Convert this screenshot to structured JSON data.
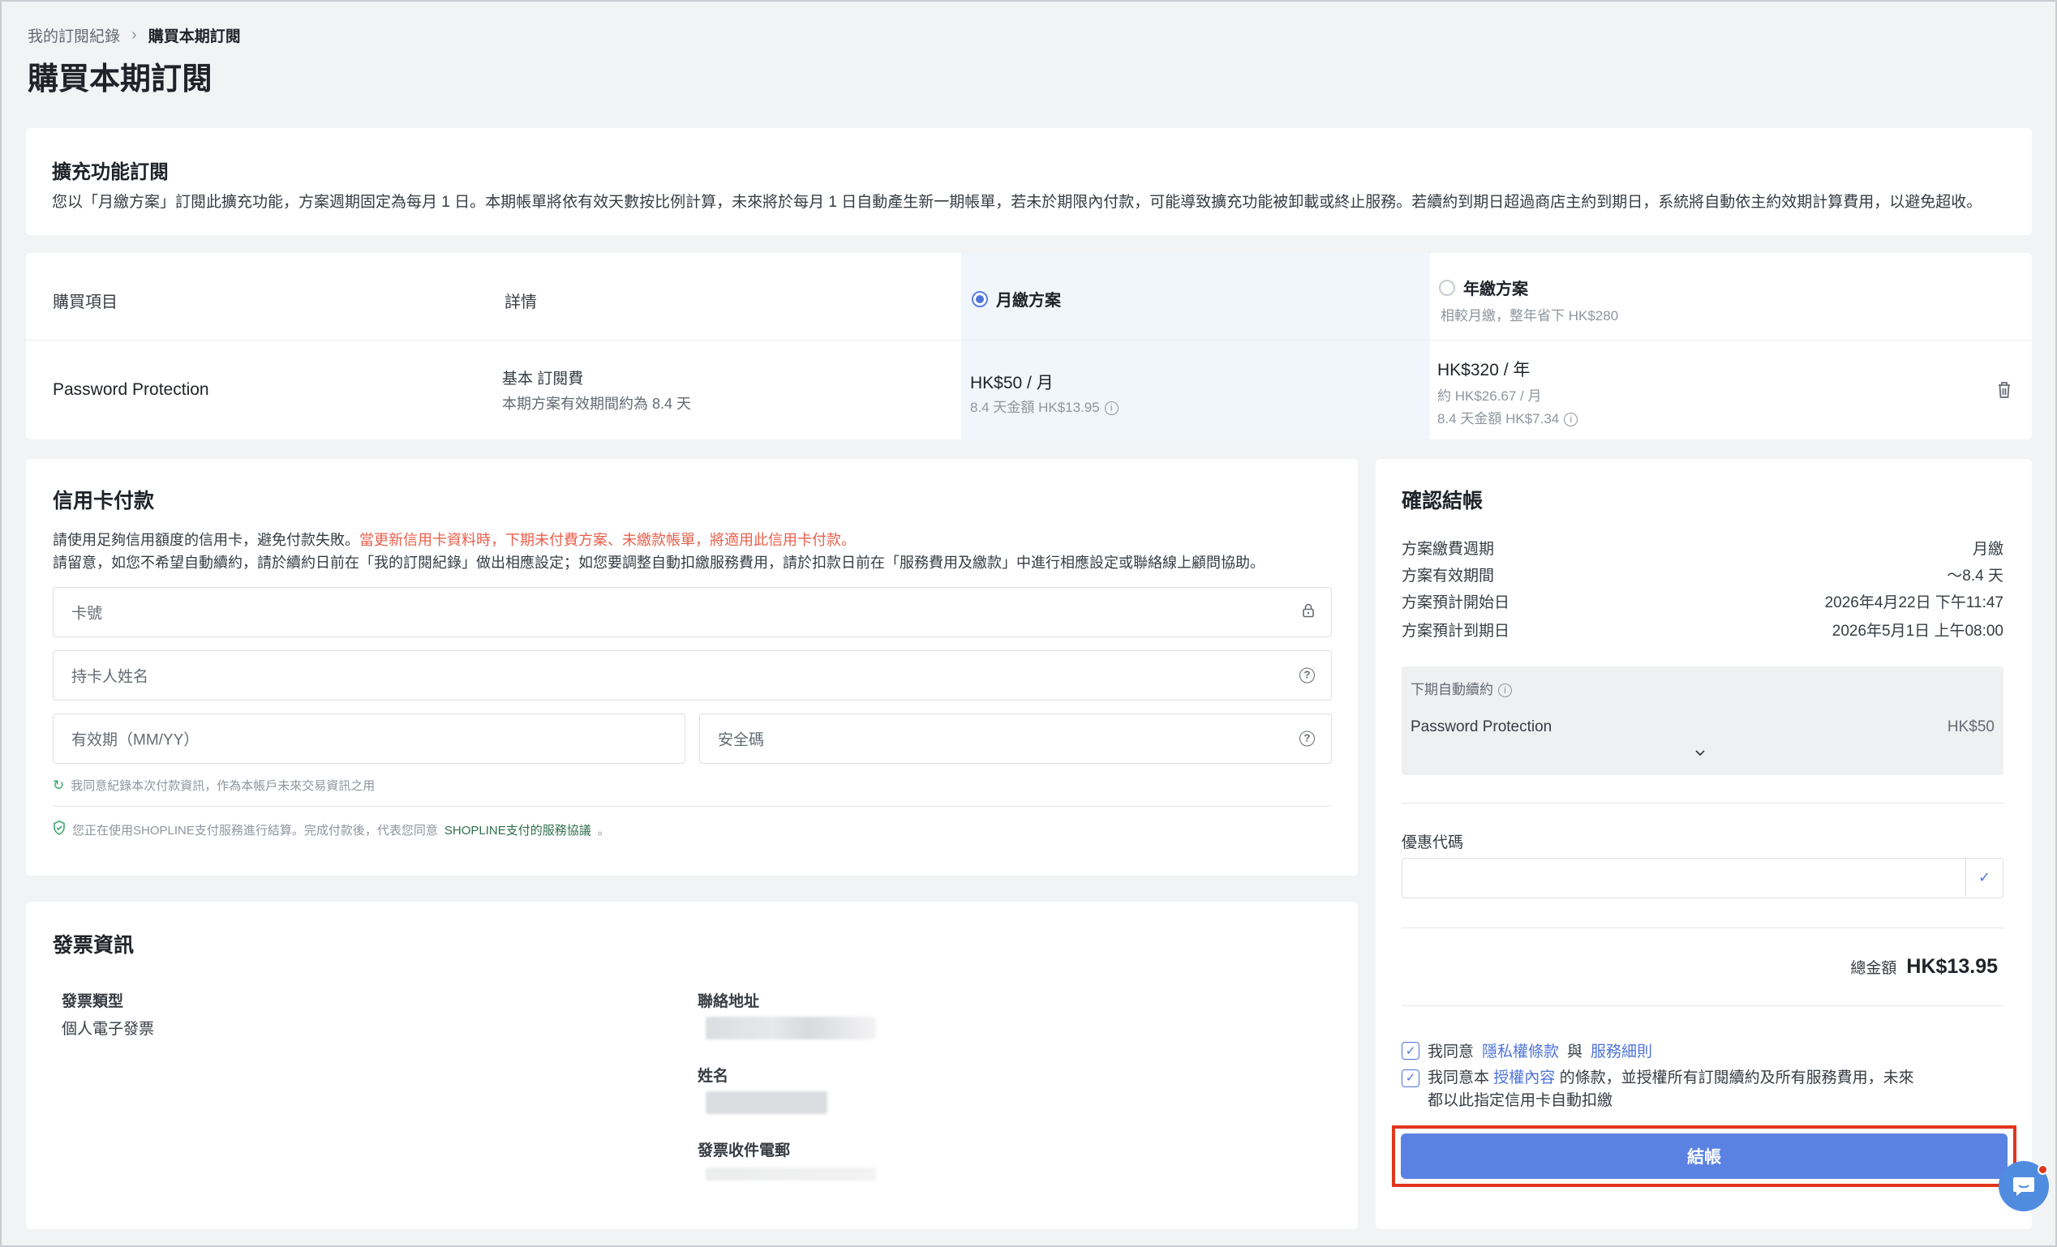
{
  "breadcrumb": {
    "parent": "我的訂閱紀錄",
    "separator": ">",
    "current": "購買本期訂閱"
  },
  "page_title": "購買本期訂閱",
  "intro": {
    "title": "擴充功能訂閱",
    "description": "您以「月繳方案」訂閱此擴充功能，方案週期固定為每月 1 日。本期帳單將依有效天數按比例計算，未來將於每月 1 日自動產生新一期帳單，若未於期限內付款，可能導致擴充功能被卸載或終止服務。若續約到期日超過商店主約到期日，系統將自動依主約效期計算費用，以避免超收。"
  },
  "plan_table": {
    "headers": {
      "item": "購買項目",
      "detail": "詳情",
      "monthly": "月繳方案",
      "yearly": "年繳方案",
      "yearly_note": "相較月繳，整年省下 HK$280"
    },
    "row": {
      "item": "Password Protection",
      "detail_title": "基本 訂閱費",
      "detail_sub": "本期方案有效期間約為 8.4 天",
      "monthly_price": "HK$50 / 月",
      "monthly_sub": "8.4 天金額 HK$13.95",
      "yearly_price": "HK$320 / 年",
      "yearly_sub1": "約 HK$26.67 / 月",
      "yearly_sub2": "8.4 天金額 HK$7.34"
    },
    "selected": "monthly"
  },
  "payment": {
    "title": "信用卡付款",
    "line1_normal": "請使用足夠信用額度的信用卡，避免付款失敗。",
    "line1_warning": "當更新信用卡資料時，下期未付費方案、未繳款帳單，將適用此信用卡付款。",
    "line2": "請留意，如您不希望自動續約，請於續約日前在「我的訂閱紀錄」做出相應設定；如您要調整自動扣繳服務費用，請於扣款日前在「服務費用及繳款」中進行相應設定或聯絡線上顧問協助。",
    "card_number_placeholder": "卡號",
    "holder_placeholder": "持卡人姓名",
    "expiry_placeholder": "有效期（MM/YY）",
    "cvc_placeholder": "安全碼",
    "remember_note": "我同意紀錄本次付款資訊，作為本帳戶未來交易資訊之用",
    "shopline_note_prefix": "您正在使用SHOPLINE支付服務進行結算。完成付款後，代表您同意",
    "shopline_note_link": "SHOPLINE支付的服務協議",
    "shopline_note_suffix": "。"
  },
  "invoice": {
    "title": "發票資訊",
    "type_label": "發票類型",
    "type_value": "個人電子發票",
    "address_label": "聯絡地址",
    "name_label": "姓名",
    "email_label": "發票收件電郵"
  },
  "summary": {
    "title": "確認結帳",
    "rows": [
      {
        "label": "方案繳費週期",
        "value": "月繳"
      },
      {
        "label": "方案有效期間",
        "value": "～8.4 天"
      },
      {
        "label": "方案預計開始日",
        "value": "2026年4月22日 下午11:47"
      },
      {
        "label": "方案預計到期日",
        "value": "2026年5月1日 上午08:00"
      }
    ],
    "renewal": {
      "label": "下期自動續約",
      "item": "Password Protection",
      "price": "HK$50"
    },
    "coupon_label": "優惠代碼",
    "coupon_value": "",
    "total_label": "總金額",
    "total_value": "HK$13.95",
    "agree1_prefix": "我同意",
    "agree1_link1": "隱私權條款",
    "agree1_mid": "與",
    "agree1_link2": "服務細則",
    "agree2_prefix": "我同意本",
    "agree2_link": "授權內容",
    "agree2_suffix": "的條款，並授權所有訂閱續約及所有服務費用，未來",
    "agree2_line2": "都以此指定信用卡自動扣繳",
    "checkout_label": "結帳"
  },
  "colors": {
    "accent": "#5b82e3",
    "warning": "#e8604c",
    "highlight": "#e0361f",
    "success": "#3aa66b"
  },
  "icons": [
    "chevron-right-icon",
    "radio-icon",
    "info-icon",
    "trash-icon",
    "lock-icon",
    "help-icon",
    "refresh-icon",
    "shield-check-icon",
    "chevron-down-icon",
    "check-icon",
    "chat-icon"
  ]
}
